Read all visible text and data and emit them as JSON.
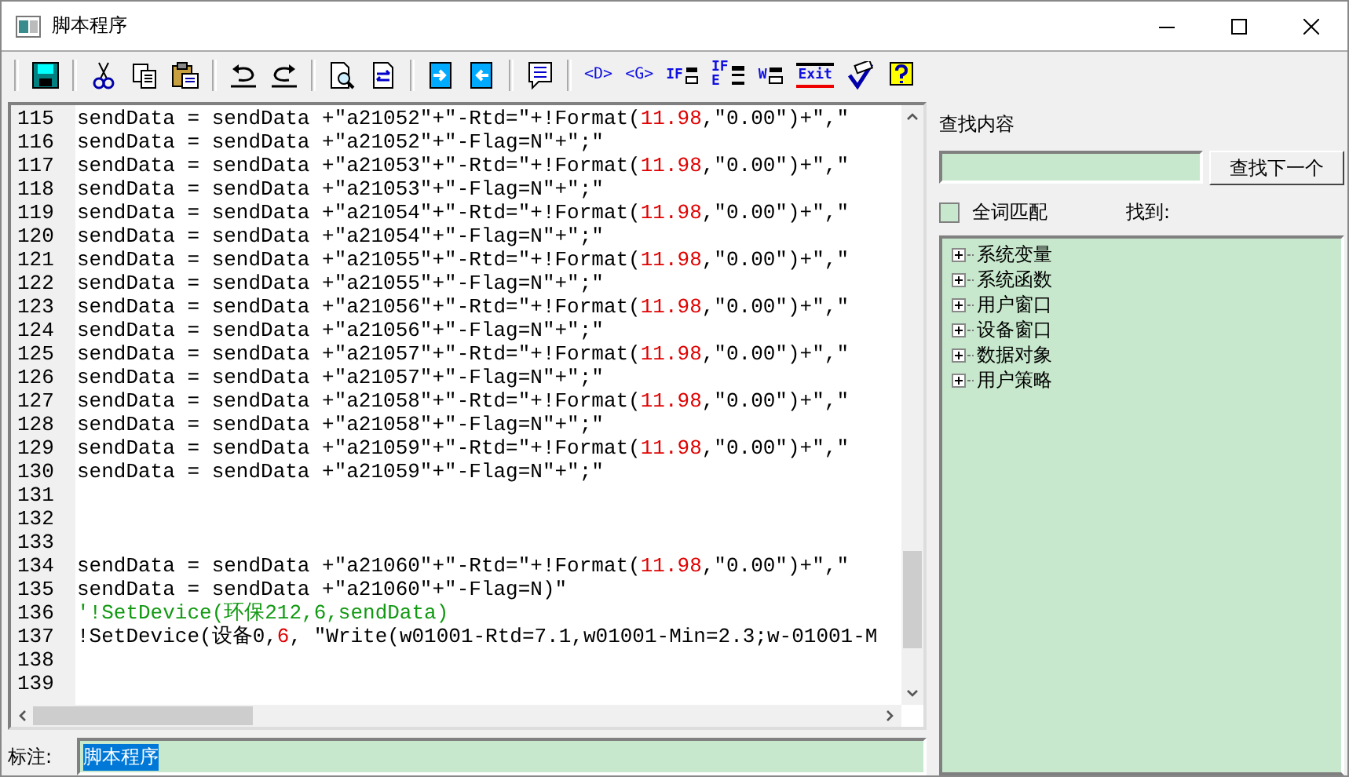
{
  "window": {
    "title": "脚本程序"
  },
  "toolbar": [
    [
      {
        "kind": "save"
      }
    ],
    [
      {
        "kind": "cut"
      },
      {
        "kind": "copy"
      },
      {
        "kind": "paste"
      }
    ],
    [
      {
        "kind": "undo"
      },
      {
        "kind": "redo"
      }
    ],
    [
      {
        "kind": "preview"
      },
      {
        "kind": "replace"
      }
    ],
    [
      {
        "kind": "import"
      },
      {
        "kind": "export"
      }
    ],
    [
      {
        "kind": "comment"
      }
    ],
    [
      {
        "kind": "tag",
        "text": "<D>"
      },
      {
        "kind": "tag",
        "text": "<G>"
      },
      {
        "kind": "if",
        "text": "IF"
      },
      {
        "kind": "ifelse",
        "text": "IF",
        "text2": "E"
      },
      {
        "kind": "while",
        "text": "W"
      },
      {
        "kind": "exit",
        "text": "Exit"
      },
      {
        "kind": "check"
      },
      {
        "kind": "help"
      }
    ]
  ],
  "editor": {
    "lines": [
      {
        "num": "115",
        "parts": [
          {
            "kind": "plain",
            "text": "sendData = sendData +″a21052″+″-Rtd=″+!Format("
          },
          {
            "kind": "number",
            "text": "11.98"
          },
          {
            "kind": "plain",
            "text": ",″0.00″)+″,″"
          }
        ]
      },
      {
        "num": "116",
        "parts": [
          {
            "kind": "plain",
            "text": "sendData = sendData +″a21052″+″-Flag=N″+″;″"
          }
        ]
      },
      {
        "num": "117",
        "parts": [
          {
            "kind": "plain",
            "text": "sendData = sendData +″a21053″+″-Rtd=″+!Format("
          },
          {
            "kind": "number",
            "text": "11.98"
          },
          {
            "kind": "plain",
            "text": ",″0.00″)+″,″"
          }
        ]
      },
      {
        "num": "118",
        "parts": [
          {
            "kind": "plain",
            "text": "sendData = sendData +″a21053″+″-Flag=N″+″;″"
          }
        ]
      },
      {
        "num": "119",
        "parts": [
          {
            "kind": "plain",
            "text": "sendData = sendData +″a21054″+″-Rtd=″+!Format("
          },
          {
            "kind": "number",
            "text": "11.98"
          },
          {
            "kind": "plain",
            "text": ",″0.00″)+″,″"
          }
        ]
      },
      {
        "num": "120",
        "parts": [
          {
            "kind": "plain",
            "text": "sendData = sendData +″a21054″+″-Flag=N″+″;″"
          }
        ]
      },
      {
        "num": "121",
        "parts": [
          {
            "kind": "plain",
            "text": "sendData = sendData +″a21055″+″-Rtd=″+!Format("
          },
          {
            "kind": "number",
            "text": "11.98"
          },
          {
            "kind": "plain",
            "text": ",″0.00″)+″,″"
          }
        ]
      },
      {
        "num": "122",
        "parts": [
          {
            "kind": "plain",
            "text": "sendData = sendData +″a21055″+″-Flag=N″+″;″"
          }
        ]
      },
      {
        "num": "123",
        "parts": [
          {
            "kind": "plain",
            "text": "sendData = sendData +″a21056″+″-Rtd=″+!Format("
          },
          {
            "kind": "number",
            "text": "11.98"
          },
          {
            "kind": "plain",
            "text": ",″0.00″)+″,″"
          }
        ]
      },
      {
        "num": "124",
        "parts": [
          {
            "kind": "plain",
            "text": "sendData = sendData +″a21056″+″-Flag=N″+″;″"
          }
        ]
      },
      {
        "num": "125",
        "parts": [
          {
            "kind": "plain",
            "text": "sendData = sendData +″a21057″+″-Rtd=″+!Format("
          },
          {
            "kind": "number",
            "text": "11.98"
          },
          {
            "kind": "plain",
            "text": ",″0.00″)+″,″"
          }
        ]
      },
      {
        "num": "126",
        "parts": [
          {
            "kind": "plain",
            "text": "sendData = sendData +″a21057″+″-Flag=N″+″;″"
          }
        ]
      },
      {
        "num": "127",
        "parts": [
          {
            "kind": "plain",
            "text": "sendData = sendData +″a21058″+″-Rtd=″+!Format("
          },
          {
            "kind": "number",
            "text": "11.98"
          },
          {
            "kind": "plain",
            "text": ",″0.00″)+″,″"
          }
        ]
      },
      {
        "num": "128",
        "parts": [
          {
            "kind": "plain",
            "text": "sendData = sendData +″a21058″+″-Flag=N″+″;″"
          }
        ]
      },
      {
        "num": "129",
        "parts": [
          {
            "kind": "plain",
            "text": "sendData = sendData +″a21059″+″-Rtd=″+!Format("
          },
          {
            "kind": "number",
            "text": "11.98"
          },
          {
            "kind": "plain",
            "text": ",″0.00″)+″,″"
          }
        ]
      },
      {
        "num": "130",
        "parts": [
          {
            "kind": "plain",
            "text": "sendData = sendData +″a21059″+″-Flag=N″+″;″"
          }
        ]
      },
      {
        "num": "131"
      },
      {
        "num": "132"
      },
      {
        "num": "133"
      },
      {
        "num": "134",
        "parts": [
          {
            "kind": "plain",
            "text": "sendData = sendData +″a21060″+″-Rtd=″+!Format("
          },
          {
            "kind": "number",
            "text": "11.98"
          },
          {
            "kind": "plain",
            "text": ",″0.00″)+″,″"
          }
        ]
      },
      {
        "num": "135",
        "parts": [
          {
            "kind": "plain",
            "text": "sendData = sendData +″a21060″+″-Flag=N)″"
          }
        ]
      },
      {
        "num": "136",
        "parts": [
          {
            "kind": "comment",
            "text": "'!SetDevice(环保212,6,sendData)"
          }
        ]
      },
      {
        "num": "137",
        "parts": [
          {
            "kind": "plain",
            "text": "!SetDevice(设备0,"
          },
          {
            "kind": "number",
            "text": "6"
          },
          {
            "kind": "plain",
            "text": ", ″Write(w01001-Rtd=7.1,w01001-Min=2.3;w-01001-M"
          }
        ]
      },
      {
        "num": "138"
      },
      {
        "num": "139"
      }
    ]
  },
  "note": {
    "label": "标注:",
    "value": "脚本程序",
    "value_selected": true
  },
  "search": {
    "label": "查找内容",
    "button": "查找下一个",
    "whole_word": {
      "label": "全词匹配",
      "checked": false
    },
    "found_label": "找到:"
  },
  "tree": [
    {
      "label": "系统变量",
      "expanded": false
    },
    {
      "label": "系统函数",
      "expanded": false
    },
    {
      "label": "用户窗口",
      "expanded": false
    },
    {
      "label": "设备窗口",
      "expanded": false
    },
    {
      "label": "数据对象",
      "expanded": false
    },
    {
      "label": "用户策略",
      "expanded": false
    }
  ]
}
